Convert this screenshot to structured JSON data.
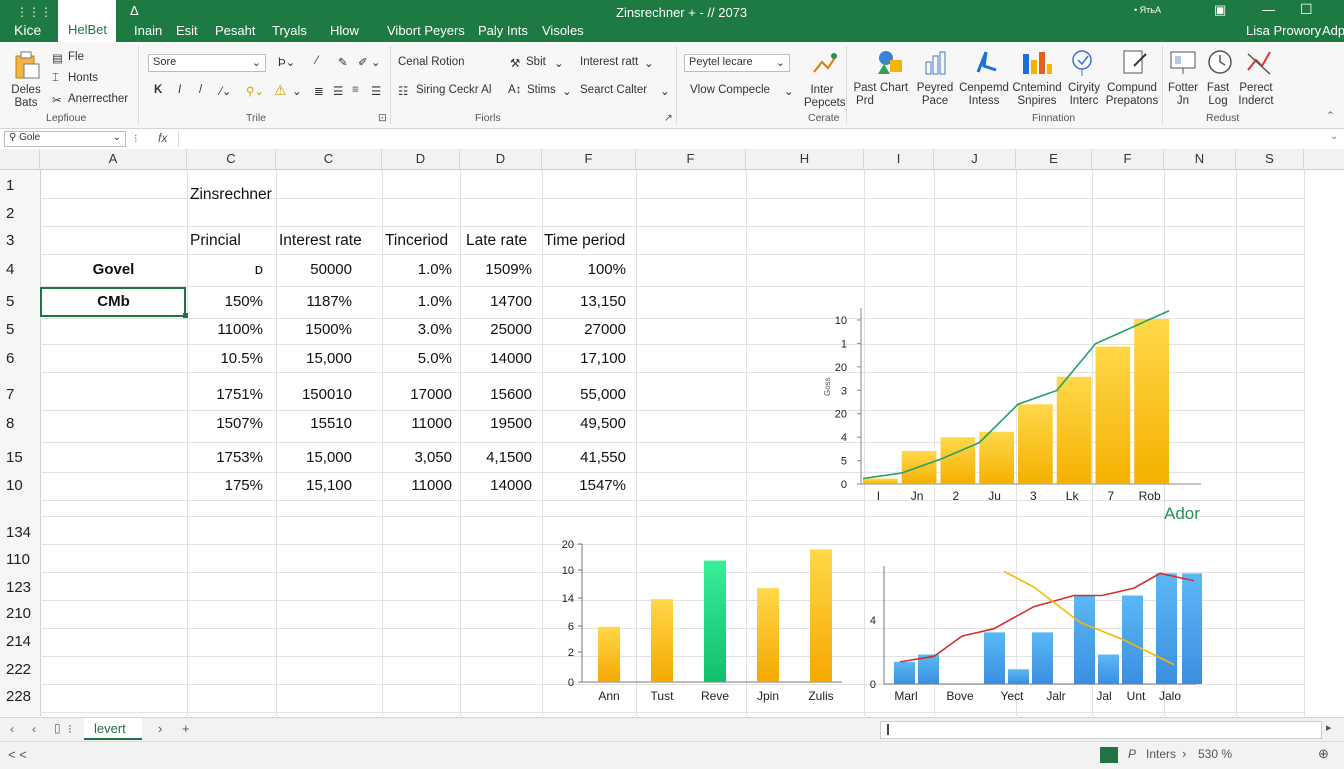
{
  "title_bar": {
    "brand": "Kice",
    "quick_glyphs": [
      "Λ",
      "←",
      "Δ"
    ],
    "doc_title": "Zinsrechner + - // 2073",
    "account": "• ЯтьА",
    "tabs": [
      "HelBet",
      "Inain",
      "Esit",
      "Pesaht",
      "Tryals",
      "Hlow",
      "Vibort Peyers",
      "Paly Ints",
      "Visoles"
    ],
    "right_label": "Lisa Prowory",
    "right_sub": "Adp"
  },
  "ribbon": {
    "clipboard": {
      "paste_label": "Deles Bats",
      "file": "Fle",
      "hosts": "Honts",
      "arrange": "Anerrecther",
      "group": "Lepfioue"
    },
    "font": {
      "font_box": "Sore",
      "group": "Trile"
    },
    "flows": {
      "item1": "Cenal Rotion",
      "item2": "Siring Ceckr Al",
      "item3": "Sbit",
      "item4": "Stims",
      "item5": "Interest ratt",
      "item6": "Searct Calter",
      "group": "Fiorls"
    },
    "create": {
      "dropdown": "Peytel lecare",
      "view": "Vlow Compecle",
      "side": "Inter Pepcets",
      "group": "Cerate"
    },
    "finance": {
      "items": [
        "Past Prd",
        "Chart",
        "Peyred Pace",
        "Cenpemd Intess",
        "Cntemind Snpires",
        "Ciryity Interc",
        "Compund Prepatons"
      ],
      "group": "Finnation"
    },
    "redust": {
      "items": [
        "Fotter Jn",
        "Fast Log",
        "Perect Inderct"
      ],
      "group": "Redust"
    }
  },
  "formula_bar": {
    "name_box": "Gole",
    "fx": "fx"
  },
  "columns": [
    "A",
    "C",
    "C",
    "D",
    "D",
    "F",
    "F",
    "H",
    "I",
    "J",
    "E",
    "F",
    "N",
    "S"
  ],
  "rows": [
    "1",
    "2",
    "3",
    "4",
    "5",
    "5",
    "6",
    "7",
    "8",
    "15",
    "10",
    "134",
    "110",
    "123",
    "210",
    "214",
    "222",
    "228"
  ],
  "sheet": {
    "title": "Zinsrechner",
    "headers": [
      "Princial",
      "Interest rate",
      "Tinceriod",
      "Late rate",
      "Time period"
    ],
    "row_labels": [
      "Govel",
      "CMb"
    ],
    "cells": [
      [
        "ᴅ",
        "50000",
        "1.0%",
        "1509%",
        "100%"
      ],
      [
        "150%",
        "1187%",
        "1.0%",
        "14700",
        "13,150"
      ],
      [
        "1100%",
        "1500%",
        "3.0%",
        "25000",
        "27000"
      ],
      [
        "10.5%",
        "15,000",
        "5.0%",
        "14000",
        "17,100"
      ],
      [
        "1751%",
        "150010",
        "17000",
        "15600",
        "55,000"
      ],
      [
        "1507%",
        "15510",
        "11000",
        "19500",
        "49,500"
      ],
      [
        "1753%",
        "15,000",
        "3,050",
        "4,1500",
        "41,550"
      ],
      [
        "175%",
        "15,100",
        "11000",
        "14000",
        "1547%"
      ]
    ]
  },
  "chart_data": [
    {
      "type": "bar",
      "title": "",
      "ylabel": "Goss",
      "y_tick_labels": [
        "0",
        "5",
        "4",
        "20",
        "3",
        "20",
        "1",
        "10"
      ],
      "categories": [
        "I",
        "Jn",
        "2",
        "Ju",
        "3",
        "Lk",
        "7",
        "Rob"
      ],
      "series": [
        {
          "name": "",
          "type": "bar",
          "values": [
            1,
            6,
            8.5,
            9.5,
            14.5,
            19.5,
            25,
            30
          ]
        },
        {
          "name": "",
          "type": "line",
          "values": [
            1,
            2,
            4.5,
            7.5,
            14.5,
            17,
            25.5,
            31.5
          ]
        }
      ],
      "legend_label": "Ador",
      "colors": {
        "bar": "#f9c21a",
        "line": "#22a06b"
      }
    },
    {
      "type": "bar",
      "y_tick_labels": [
        "0",
        "2",
        "6",
        "14",
        "10",
        "20"
      ],
      "categories": [
        "Ann",
        "Tust",
        "Reve",
        "Jpin",
        "Zulis"
      ],
      "values": [
        6,
        9,
        13.2,
        10.2,
        14.4
      ],
      "colors": [
        "#f9c21a",
        "#f9c21a",
        "#22d482",
        "#f9c21a",
        "#f9c21a"
      ]
    },
    {
      "type": "bar",
      "y_tick_labels": [
        "0",
        "4"
      ],
      "categories": [
        "Marl",
        "Bove",
        "Yect",
        "Jalr",
        "Jal",
        "Unt",
        "Jalo"
      ],
      "series": [
        {
          "name": "",
          "type": "bar",
          "values": [
            3,
            4,
            0,
            7,
            2,
            7,
            0,
            12,
            4,
            12,
            15,
            15
          ]
        },
        {
          "name": "",
          "type": "line",
          "values": [
            4,
            5,
            8,
            9,
            13,
            16,
            15,
            12,
            15,
            12
          ]
        },
        {
          "name": "",
          "type": "line",
          "values": [
            4,
            5,
            8,
            9,
            13,
            16,
            15,
            12,
            15,
            12
          ]
        }
      ],
      "colors": {
        "bar": "#4aa8f0",
        "line1": "#d32f2f",
        "line2": "#f5b800"
      }
    }
  ],
  "sheet_tabs": {
    "active": "levert",
    "nav": [
      "‹",
      "›",
      "+"
    ]
  },
  "status_bar": {
    "left": "< <",
    "right": "Inters",
    "zoom": "530 %"
  }
}
